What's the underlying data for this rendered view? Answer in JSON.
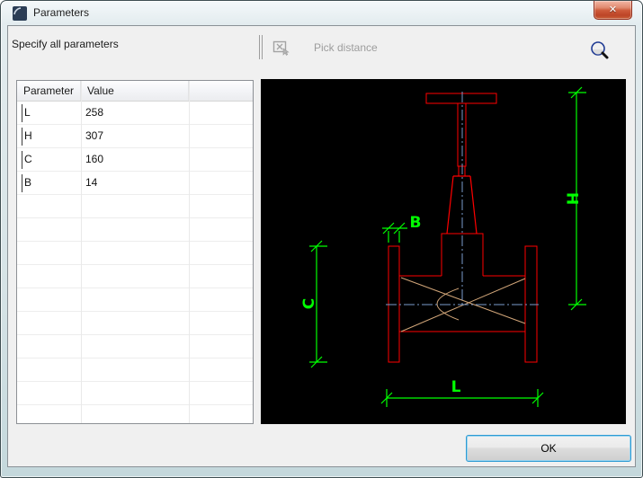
{
  "window": {
    "title": "Parameters",
    "close_glyph": "✕"
  },
  "toolbar": {
    "instruction": "Specify all parameters",
    "pick_distance_label": "Pick distance"
  },
  "parameters_table": {
    "columns": [
      "Parameter",
      "Value"
    ],
    "rows": [
      {
        "parameter": "L",
        "value": "258"
      },
      {
        "parameter": "H",
        "value": "307"
      },
      {
        "parameter": "C",
        "value": "160"
      },
      {
        "parameter": "B",
        "value": "14"
      }
    ],
    "empty_rows": 10
  },
  "preview": {
    "dimension_labels": {
      "height": "H",
      "flange_thickness": "B",
      "center_height": "C",
      "length": "L"
    },
    "colors": {
      "background": "#000000",
      "outline": "#ff0000",
      "dimension": "#00ff00",
      "centerline": "#7a9ccc",
      "wedge": "#d2a679"
    }
  },
  "footer": {
    "ok_label": "OK"
  }
}
